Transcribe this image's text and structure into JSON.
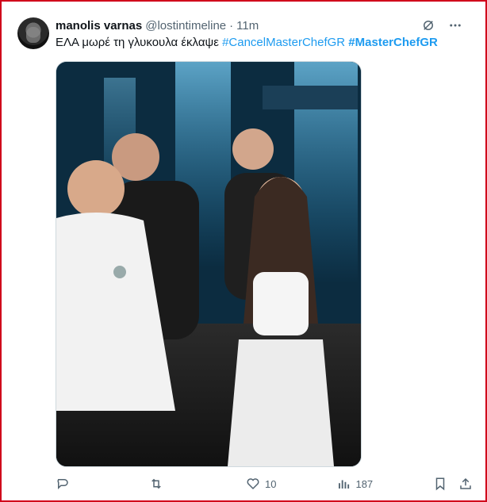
{
  "tweet": {
    "author_name": "manolis varnas",
    "author_handle": "@lostintimeline",
    "separator": "·",
    "time": "11m",
    "text_plain": "ΕΛΑ μωρέ τη γλυκουλα έκλαψε",
    "hashtag_1": "#CancelMasterChefGR",
    "hashtag_2": "#MasterChefGR",
    "media_alt": "Four contestants standing on a TV studio set with blue stage lights"
  },
  "actions": {
    "reply_count": "",
    "retweet_count": "",
    "like_count": "10",
    "views_count": "187"
  },
  "icons": {
    "grok": "grok-icon",
    "more": "more-icon",
    "reply": "reply-icon",
    "retweet": "retweet-icon",
    "like": "heart-icon",
    "views": "views-icon",
    "bookmark": "bookmark-icon",
    "share": "share-icon"
  },
  "colors": {
    "accent": "#1d9bf0",
    "muted": "#536471",
    "text": "#0f1419",
    "border": "#d0021b"
  }
}
